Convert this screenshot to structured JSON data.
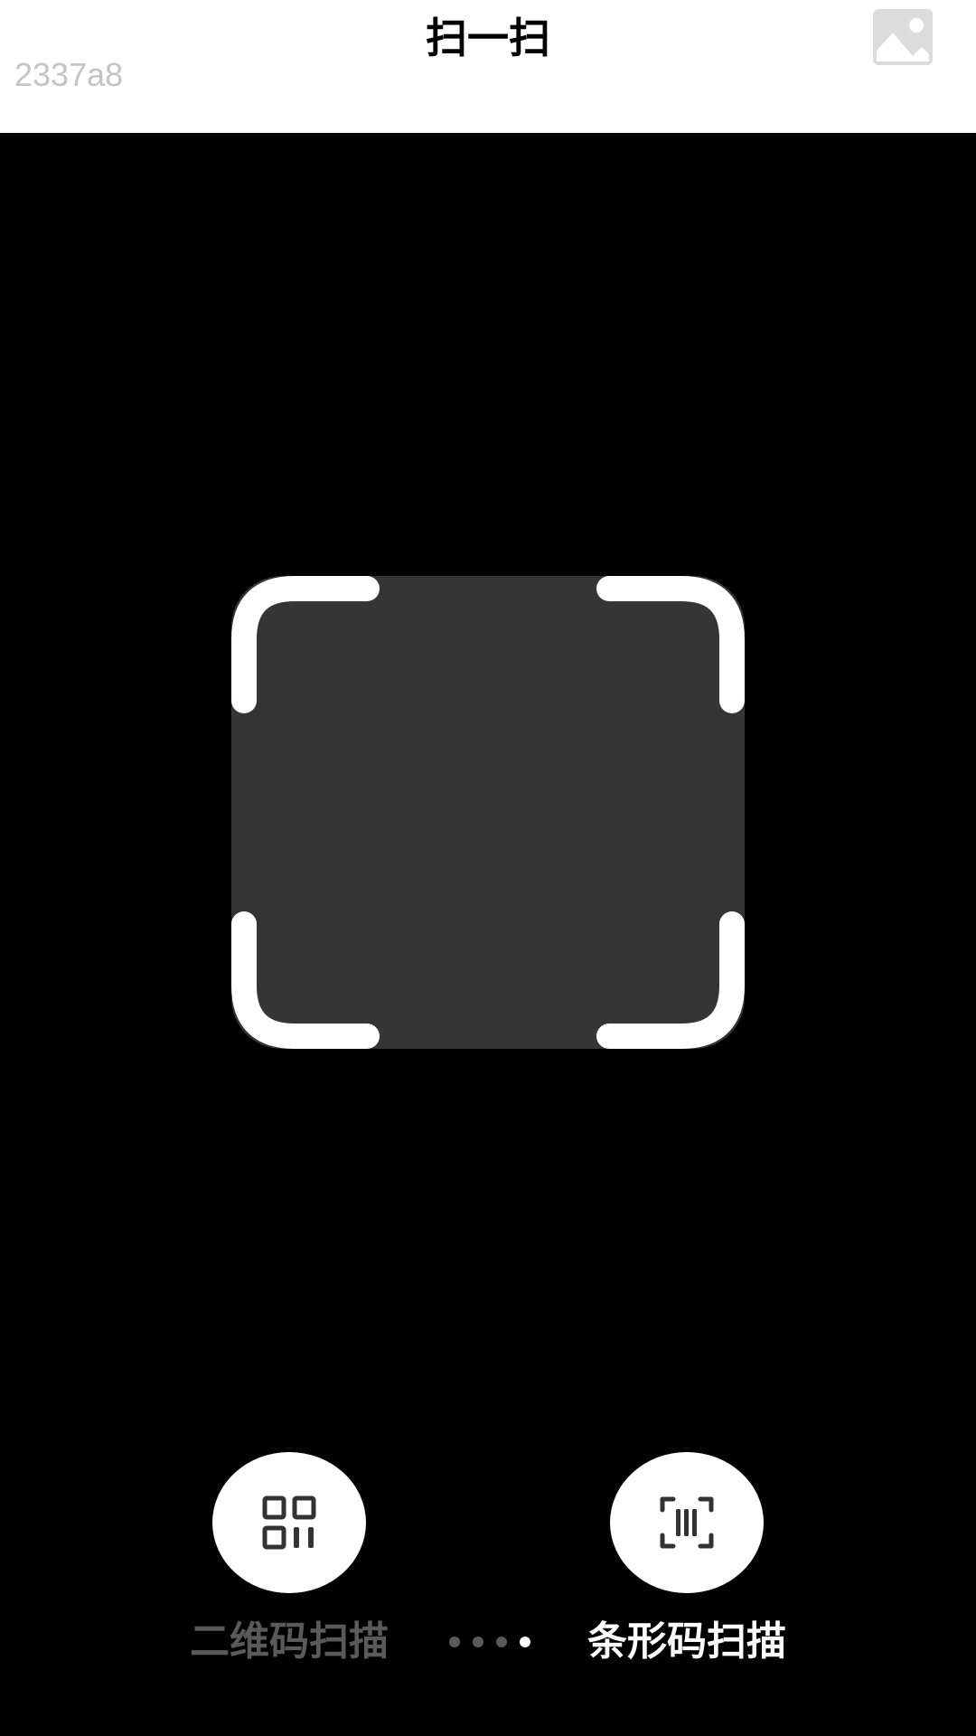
{
  "header": {
    "title": "扫一扫",
    "code_label": "2337a8",
    "gallery_icon": "image-icon"
  },
  "scanner": {
    "frame_icon": "scan-frame-icon"
  },
  "modes": [
    {
      "label": "二维码扫描",
      "icon": "qr-code-icon",
      "active": false
    },
    {
      "label": "条形码扫描",
      "icon": "barcode-icon",
      "active": true
    }
  ],
  "pager": {
    "count": 4,
    "active_index": 3
  },
  "colors": {
    "background": "#000000",
    "header_bg": "#ffffff",
    "scan_area": "#353535",
    "active_text": "#ffffff",
    "inactive_text": "#5a5a5a"
  }
}
